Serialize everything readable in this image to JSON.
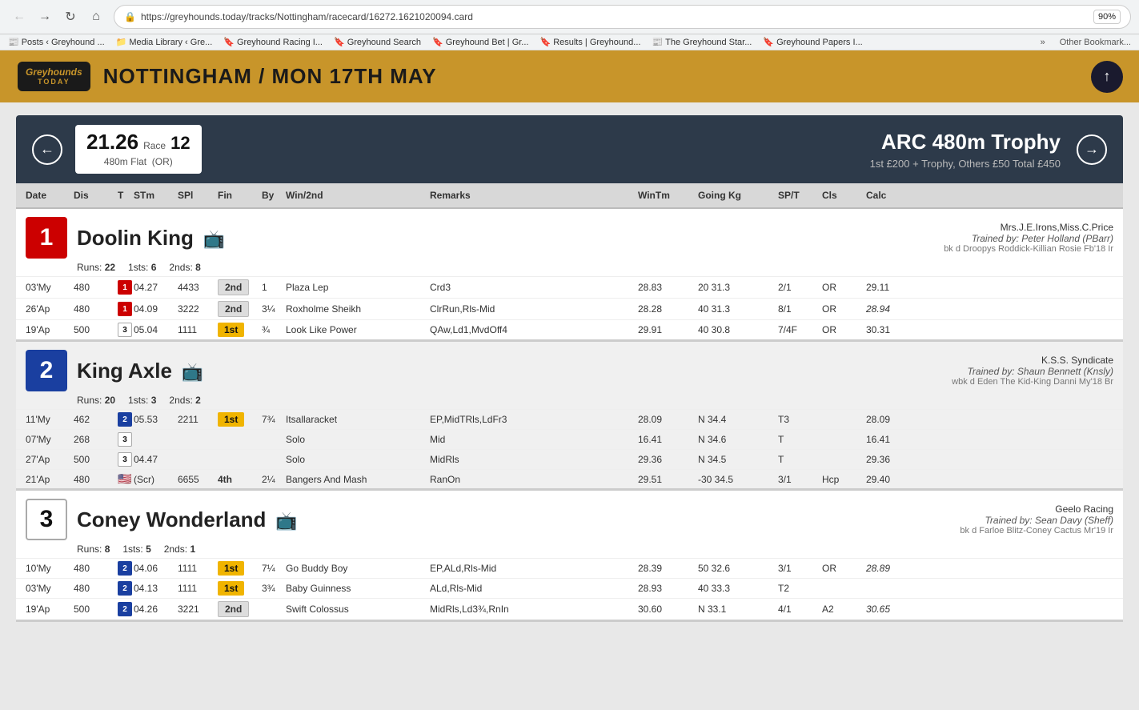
{
  "browser": {
    "url": "https://greyhounds.today/tracks/Nottingham/racecard/16272.1621020094.card",
    "zoom": "90%",
    "bookmarks": [
      "Posts ‹ Greyhound ...",
      "Media Library ‹ Gre...",
      "Greyhound Racing I...",
      "Greyhound Search",
      "Greyhound Bet | Gr...",
      "Results | Greyhound...",
      "The Greyhound Star...",
      "Greyhound Papers I..."
    ]
  },
  "site": {
    "logo_line1": "Greyhounds",
    "logo_line2": "TODAY",
    "title": "Nottingham / Mon 17th May",
    "up_arrow": "↑"
  },
  "race": {
    "time": "21.26",
    "race_label": "Race",
    "race_num": "12",
    "dist_label": "480m Flat",
    "or_label": "(OR)",
    "name": "ARC 480m Trophy",
    "prize": "1st £200 + Trophy, Others £50 Total £450"
  },
  "col_headers": {
    "date": "Date",
    "dis": "Dis",
    "t": "T",
    "stm": "STm",
    "spl": "SPl",
    "fin": "Fin",
    "by": "By",
    "win2nd": "Win/2nd",
    "remarks": "Remarks",
    "wintm": "WinTm",
    "goingkg": "Going Kg",
    "spt": "SP/T",
    "cls": "Cls",
    "calc": "Calc"
  },
  "dogs": [
    {
      "trap": "1",
      "trap_class": "trap-1",
      "name": "Doolin King",
      "owner": "Mrs.J.E.Irons,Miss.C.Price",
      "trainer": "Trained by: Peter Holland (PBarr)",
      "breed": "bk d Droopys Roddick-Killian Rosie Fb'18 Ir",
      "runs": "22",
      "sts": "6",
      "nds": "8",
      "races": [
        {
          "date": "03'My",
          "dis": "480",
          "trap": "1",
          "trap_class": "t1",
          "stm": "04.27",
          "spl": "4433",
          "fin": "2nd",
          "fin_class": "fin-2nd",
          "by": "1",
          "win2nd": "Plaza Lep",
          "remarks": "Crd3",
          "wintm": "28.83",
          "going": "20",
          "kg": "31.3",
          "spt": "2/1",
          "cls": "OR",
          "calc": "29.11"
        },
        {
          "date": "26'Ap",
          "dis": "480",
          "trap": "1",
          "trap_class": "t1",
          "stm": "04.09",
          "spl": "3222",
          "fin": "2nd",
          "fin_class": "fin-2nd",
          "by": "3¼",
          "win2nd": "Roxholme Sheikh",
          "remarks": "ClrRun,Rls-Mid",
          "wintm": "28.28",
          "going": "40",
          "kg": "31.3",
          "spt": "8/1",
          "cls": "OR",
          "calc": "28.94",
          "calc_italic": true
        },
        {
          "date": "19'Ap",
          "dis": "500",
          "trap": "3",
          "trap_class": "t3",
          "stm": "05.04",
          "spl": "1111",
          "fin": "1st",
          "fin_class": "fin-1st",
          "by": "¾",
          "win2nd": "Look Like Power",
          "remarks": "QAw,Ld1,MvdOff4",
          "wintm": "29.91",
          "going": "40",
          "kg": "30.8",
          "spt": "7/4F",
          "cls": "OR",
          "calc": "30.31"
        }
      ]
    },
    {
      "trap": "2",
      "trap_class": "trap-2",
      "name": "King Axle",
      "owner": "K.S.S. Syndicate",
      "trainer": "Trained by: Shaun Bennett (Knsly)",
      "breed": "wbk d Eden The Kid-King Danni My'18 Br",
      "runs": "20",
      "sts": "3",
      "nds": "2",
      "races": [
        {
          "date": "11'My",
          "dis": "462",
          "trap": "2",
          "trap_class": "t2",
          "stm": "05.53",
          "spl": "2211",
          "fin": "1st",
          "fin_class": "fin-1st",
          "by": "7¾",
          "win2nd": "Itsallaracket",
          "remarks": "EP,MidTRls,LdFr3",
          "wintm": "28.09",
          "going": "N",
          "kg": "34.4",
          "spt": "T3",
          "cls": "",
          "calc": "28.09"
        },
        {
          "date": "07'My",
          "dis": "268",
          "trap": "3",
          "trap_class": "t3",
          "stm": "",
          "spl": "",
          "fin": "",
          "fin_class": "",
          "by": "",
          "win2nd": "Solo",
          "remarks": "Mid",
          "wintm": "16.41",
          "going": "N",
          "kg": "34.6",
          "spt": "T",
          "cls": "",
          "calc": "16.41"
        },
        {
          "date": "27'Ap",
          "dis": "500",
          "trap": "3",
          "trap_class": "t3",
          "stm": "04.47",
          "spl": "",
          "fin": "",
          "fin_class": "",
          "by": "",
          "win2nd": "Solo",
          "remarks": "MidRls",
          "wintm": "29.36",
          "going": "N",
          "kg": "34.5",
          "spt": "T",
          "cls": "",
          "calc": "29.36"
        },
        {
          "date": "21'Ap",
          "dis": "480",
          "trap": "flag",
          "trap_class": "t-flag",
          "stm": "(Scr)",
          "spl": "6655",
          "fin": "4th",
          "fin_class": "fin-4th",
          "by": "2¼",
          "win2nd": "Bangers And Mash",
          "remarks": "RanOn",
          "wintm": "29.51",
          "going": "-30",
          "kg": "34.5",
          "spt": "3/1",
          "cls": "Hcp",
          "calc": "29.40"
        }
      ]
    },
    {
      "trap": "3",
      "trap_class": "trap-3",
      "name": "Coney Wonderland",
      "owner": "Geelo Racing",
      "trainer": "Trained by: Sean Davy (Sheff)",
      "breed": "bk d Farloe Blitz-Coney Cactus Mr'19 Ir",
      "runs": "8",
      "sts": "5",
      "nds": "1",
      "races": [
        {
          "date": "10'My",
          "dis": "480",
          "trap": "2",
          "trap_class": "t2",
          "stm": "04.06",
          "spl": "1111",
          "fin": "1st",
          "fin_class": "fin-1st",
          "by": "7¼",
          "win2nd": "Go Buddy Boy",
          "remarks": "EP,ALd,Rls-Mid",
          "wintm": "28.39",
          "going": "50",
          "kg": "32.6",
          "spt": "3/1",
          "cls": "OR",
          "calc": "28.89",
          "calc_italic": true
        },
        {
          "date": "03'My",
          "dis": "480",
          "trap": "2",
          "trap_class": "t2",
          "stm": "04.13",
          "spl": "1111",
          "fin": "1st",
          "fin_class": "fin-1st",
          "by": "3¾",
          "win2nd": "Baby Guinness",
          "remarks": "ALd,Rls-Mid",
          "wintm": "28.93",
          "going": "40",
          "kg": "33.3",
          "spt": "T2",
          "cls": "",
          "calc": ""
        },
        {
          "date": "19'Ap",
          "dis": "500",
          "trap": "2",
          "trap_class": "t2",
          "stm": "04.26",
          "spl": "3221",
          "fin": "2nd",
          "fin_class": "fin-2nd",
          "by": "",
          "win2nd": "Swift Colossus",
          "remarks": "MidRls,Ld3¾,RnIn",
          "wintm": "30.60",
          "going": "N",
          "kg": "33.1",
          "spt": "4/1",
          "cls": "A2",
          "calc": "30.65",
          "calc_italic": true
        }
      ]
    }
  ]
}
